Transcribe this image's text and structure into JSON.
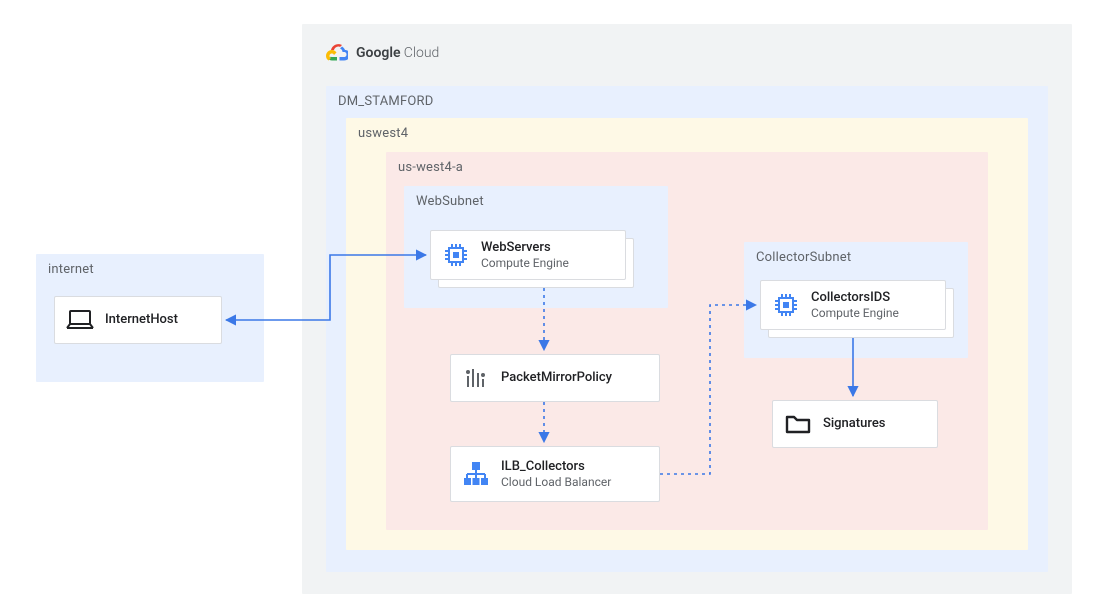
{
  "brand": {
    "strong": "Google",
    "light": "Cloud"
  },
  "internet": {
    "label": "internet",
    "host": "InternetHost"
  },
  "project": {
    "label": "DM_STAMFORD"
  },
  "region": {
    "label": "uswest4"
  },
  "zone": {
    "label": "us-west4-a"
  },
  "websubnet": {
    "label": "WebSubnet"
  },
  "collectorsubnet": {
    "label": "CollectorSubnet"
  },
  "nodes": {
    "web": {
      "title": "WebServers",
      "sub": "Compute Engine"
    },
    "pmp": {
      "title": "PacketMirrorPolicy"
    },
    "ilb": {
      "title": "ILB_Collectors",
      "sub": "Cloud Load Balancer"
    },
    "cids": {
      "title": "CollectorsIDS",
      "sub": "Compute Engine"
    },
    "sig": {
      "title": "Signatures"
    }
  },
  "colors": {
    "arrow": "#3b78e7",
    "icon_blue": "#4285f4"
  }
}
